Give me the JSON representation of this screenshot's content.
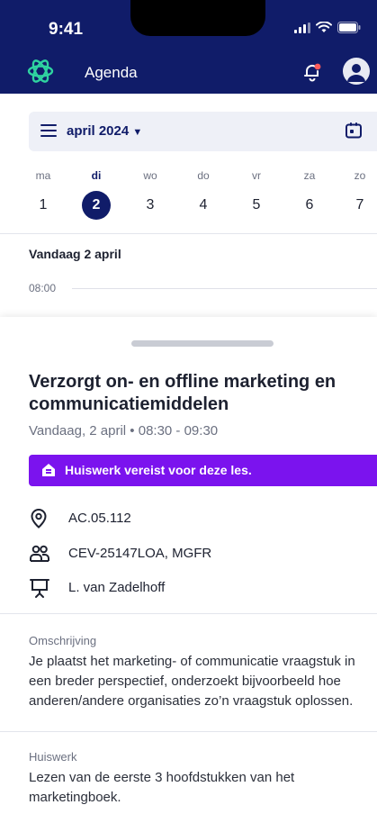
{
  "status_bar": {
    "time": "9:41"
  },
  "app": {
    "title": "Agenda"
  },
  "colors": {
    "primary": "#101c69",
    "accent": "#7b13ee",
    "logo": "#2fd3a0"
  },
  "calendar": {
    "month": "april 2024",
    "days": [
      {
        "name": "ma",
        "date": "1"
      },
      {
        "name": "di",
        "date": "2"
      },
      {
        "name": "wo",
        "date": "3"
      },
      {
        "name": "do",
        "date": "4"
      },
      {
        "name": "vr",
        "date": "5"
      },
      {
        "name": "za",
        "date": "6"
      },
      {
        "name": "zo",
        "date": "7"
      }
    ],
    "selected_day": "2",
    "today_label": "Vandaag 2 april",
    "first_hour": "08:00"
  },
  "event": {
    "title": "Verzorgt on- en offline marketing en communicatiemiddelen",
    "time": "Vandaag, 2 april • 08:30 - 09:30",
    "homework_banner": "Huiswerk vereist voor deze les.",
    "location": "AC.05.112",
    "groups": "CEV-25147LOA, MGFR",
    "teacher": "L. van Zadelhoff",
    "description_label": "Omschrijving",
    "description": "Je plaatst het marketing- of communicatie vraagstuk in een breder perspectief, onderzoekt bijvoorbeeld hoe anderen/andere organisaties zo’n vraagstuk oplossen.",
    "homework_label": "Huiswerk",
    "homework": "Lezen van de eerste 3 hoofdstukken van het marketingboek."
  },
  "icons": {
    "logo": "app-logo-icon",
    "bell": "bell-icon",
    "avatar": "avatar-icon",
    "menu": "menu-icon",
    "calendar": "calendar-icon",
    "homework": "homework-icon",
    "location": "location-pin-icon",
    "groups": "people-icon",
    "teacher": "presentation-icon"
  }
}
